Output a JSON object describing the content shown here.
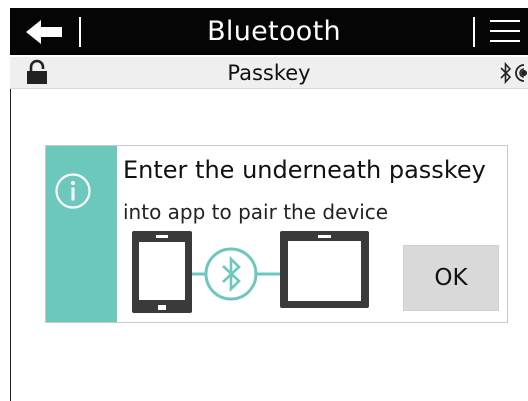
{
  "header": {
    "title": "Bluetooth",
    "back_icon": "back-arrow-icon",
    "menu_icon": "hamburger-menu-icon"
  },
  "subheader": {
    "title": "Passkey",
    "left_icon": "lock-icon",
    "status_icons": [
      "bluetooth-icon",
      "signal-icon"
    ]
  },
  "dialog": {
    "icon": "info-icon",
    "line1": "Enter the underneath passkey",
    "line2": "into app to pair the device",
    "graphic_icons": [
      "tablet-icon",
      "bluetooth-icon",
      "panel-icon"
    ],
    "ok_label": "OK"
  },
  "colors": {
    "header_bg": "#050505",
    "subheader_bg": "#efefef",
    "accent": "#6cc8bd",
    "device_fill": "#3a3a3a",
    "button_bg": "#d9d9d9"
  }
}
